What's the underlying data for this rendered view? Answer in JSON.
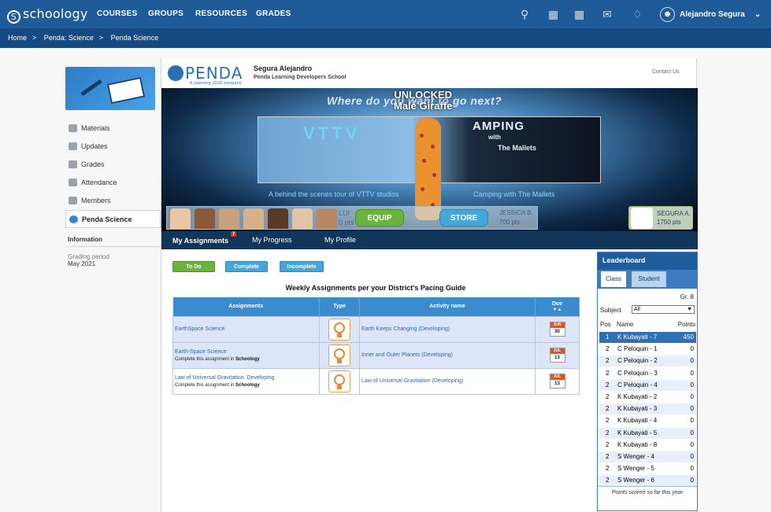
{
  "app": {
    "logo": "schoology",
    "nav": [
      "COURSES",
      "GROUPS",
      "RESOURCES",
      "GRADES"
    ],
    "icons": [
      "search-icon",
      "apps-icon",
      "calendar-icon",
      "mail-icon",
      "bell-icon"
    ],
    "user_name": "Alejandro Segura"
  },
  "breadcrumb": [
    "Home",
    "Penda: Science",
    "Penda Science"
  ],
  "sidebar": {
    "items": [
      {
        "label": "Materials",
        "icon": "materials-icon"
      },
      {
        "label": "Updates",
        "icon": "updates-icon"
      },
      {
        "label": "Grades",
        "icon": "grades-icon"
      },
      {
        "label": "Attendance",
        "icon": "attendance-icon"
      },
      {
        "label": "Members",
        "icon": "members-icon"
      },
      {
        "label": "Penda Science",
        "icon": "penda-icon"
      }
    ],
    "info_heading": "Information",
    "grading_label": "Grading period",
    "grading_value": "May 2021"
  },
  "penda": {
    "logo": "PENDA",
    "logo_sub": "A Learning 2020 company",
    "student_name": "Segura Alejandro",
    "school": "Penda Learning Developers School",
    "contact": "Contact Us",
    "hero": {
      "question": "Where do you want to go next?",
      "unlocked_1": "UNLOCKED",
      "unlocked_2": "Male Giraffe",
      "vttv": "VTTV",
      "camping": "AMPING",
      "with": "with",
      "mallets": "The Mallets",
      "caption_left": "A behind the scenes tour of VTTV studios",
      "caption_right": "Camping with The Mallets",
      "rival_name": "LUI",
      "rival_pts": "0 pts",
      "jessica_name": "JESSICA B.",
      "jessica_pts": "700 pts",
      "equip": "EQUIP",
      "store": "STORE",
      "me_name": "SEGURA A.",
      "me_pts": "1750 pts"
    },
    "tabs": [
      {
        "label": "My Assignments",
        "badge": "7"
      },
      {
        "label": "My Progress"
      },
      {
        "label": "My Profile"
      }
    ],
    "filters": [
      "To Do",
      "Complete",
      "Incomplete"
    ],
    "table_title": "Weekly Assignments per your District's Pacing Guide",
    "columns": [
      "Assignments",
      "Type",
      "Activity name",
      "Due"
    ],
    "rows": [
      {
        "assignment": "EarthSpace Science",
        "note": "",
        "note_app": "",
        "activity": "Earth Keeps Changing (Developing)",
        "due_month": "JUN",
        "due_day": "30"
      },
      {
        "assignment": "Earth-Space Science",
        "note": "Complete this assignment in",
        "note_app": "Schoology",
        "activity": "Inner and Outer Planets (Developing)",
        "due_month": "JUL",
        "due_day": "13"
      },
      {
        "assignment": "Law of Universal Gravitation. Developing",
        "note": "Complete this assignment in",
        "note_app": "Schoology",
        "activity": "Law of Universal Gravitation (Developing)",
        "due_month": "JUL",
        "due_day": "13"
      }
    ]
  },
  "leaderboard": {
    "title": "Leaderboard",
    "tabs": [
      "Class",
      "Student"
    ],
    "grade": "Gr. 8",
    "subject_label": "Subject",
    "subject_value": "All",
    "cols": [
      "Pos",
      "Name",
      "Points"
    ],
    "rows": [
      {
        "pos": "1",
        "name": "K Kubayati - 7",
        "points": "450"
      },
      {
        "pos": "2",
        "name": "C Peloquin - 1",
        "points": "0"
      },
      {
        "pos": "2",
        "name": "C Peloquin - 2",
        "points": "0"
      },
      {
        "pos": "2",
        "name": "C Peloquin - 3",
        "points": "0"
      },
      {
        "pos": "2",
        "name": "C Peloquin - 4",
        "points": "0"
      },
      {
        "pos": "2",
        "name": "K Kubayati - 2",
        "points": "0"
      },
      {
        "pos": "2",
        "name": "K Kubayati - 3",
        "points": "0"
      },
      {
        "pos": "2",
        "name": "K Kubayati - 4",
        "points": "0"
      },
      {
        "pos": "2",
        "name": "K Kubayati - 5",
        "points": "0"
      },
      {
        "pos": "2",
        "name": "K Kubayati - 8",
        "points": "0"
      },
      {
        "pos": "2",
        "name": "S Wenger - 4",
        "points": "0"
      },
      {
        "pos": "2",
        "name": "S Wenger - 5",
        "points": "0"
      },
      {
        "pos": "2",
        "name": "S Wenger - 6",
        "points": "0"
      }
    ],
    "note": "Points scored so far this year"
  }
}
